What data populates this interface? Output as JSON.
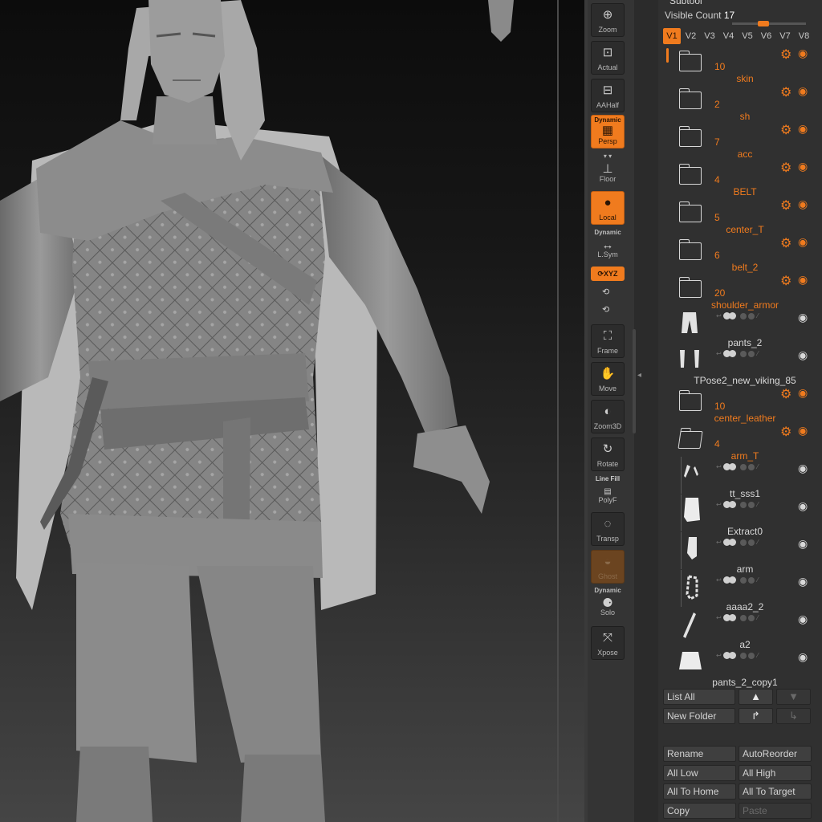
{
  "toolbar": {
    "zoom": "Zoom",
    "actual": "Actual",
    "aahalf": "AAHalf",
    "persp_top": "Dynamic",
    "persp": "Persp",
    "floor": "Floor",
    "local": "Local",
    "lsym_top": "Dynamic",
    "lsym": "L.Sym",
    "xyz": "XYZ",
    "frame": "Frame",
    "move": "Move",
    "zoom3d": "Zoom3D",
    "rotate": "Rotate",
    "polyf_top": "Line Fill",
    "polyf": "PolyF",
    "transp": "Transp",
    "ghost": "Ghost",
    "solo_top": "Dynamic",
    "solo": "Solo",
    "xpose": "Xpose"
  },
  "panel": {
    "title": "Subtool",
    "visible_label": "Visible Count",
    "visible_count": "17",
    "visible_slider_level": 0.4,
    "tabs": [
      "V1",
      "V2",
      "V3",
      "V4",
      "V5",
      "V6",
      "V7",
      "V8"
    ],
    "active_tab": "V1",
    "items": [
      {
        "type": "folder",
        "count": "10",
        "name": "skin"
      },
      {
        "type": "folder",
        "count": "2",
        "name": "sh"
      },
      {
        "type": "folder",
        "count": "7",
        "name": "acc"
      },
      {
        "type": "folder",
        "count": "4",
        "name": "BELT"
      },
      {
        "type": "folder",
        "count": "5",
        "name": "center_T"
      },
      {
        "type": "folder",
        "count": "6",
        "name": "belt_2"
      },
      {
        "type": "folder",
        "count": "20",
        "name": "shoulder_armor"
      },
      {
        "type": "mesh",
        "name": "pants_2"
      },
      {
        "type": "mesh",
        "name": "TPose2_new_viking_85"
      },
      {
        "type": "folder",
        "count": "10",
        "name": "center_leather"
      },
      {
        "type": "folder-open",
        "count": "4",
        "name": "arm_T"
      },
      {
        "type": "mesh",
        "name": "tt_sss1"
      },
      {
        "type": "mesh",
        "name": "Extract0"
      },
      {
        "type": "mesh",
        "name": "arm"
      },
      {
        "type": "mesh",
        "name": "aaaa2_2"
      },
      {
        "type": "mesh",
        "name": "a2"
      },
      {
        "type": "mesh",
        "name": "pants_2_copy1"
      }
    ],
    "buttons": {
      "list_all": "List All",
      "new_folder": "New Folder",
      "rename": "Rename",
      "autoreorder": "AutoReorder",
      "all_low": "All Low",
      "all_high": "All High",
      "all_to_home": "All To Home",
      "all_to_target": "All To Target",
      "copy": "Copy",
      "paste": "Paste"
    }
  },
  "colors": {
    "accent": "#f07b1e",
    "panel_bg": "#303030",
    "toolbar_bg": "#343434"
  }
}
